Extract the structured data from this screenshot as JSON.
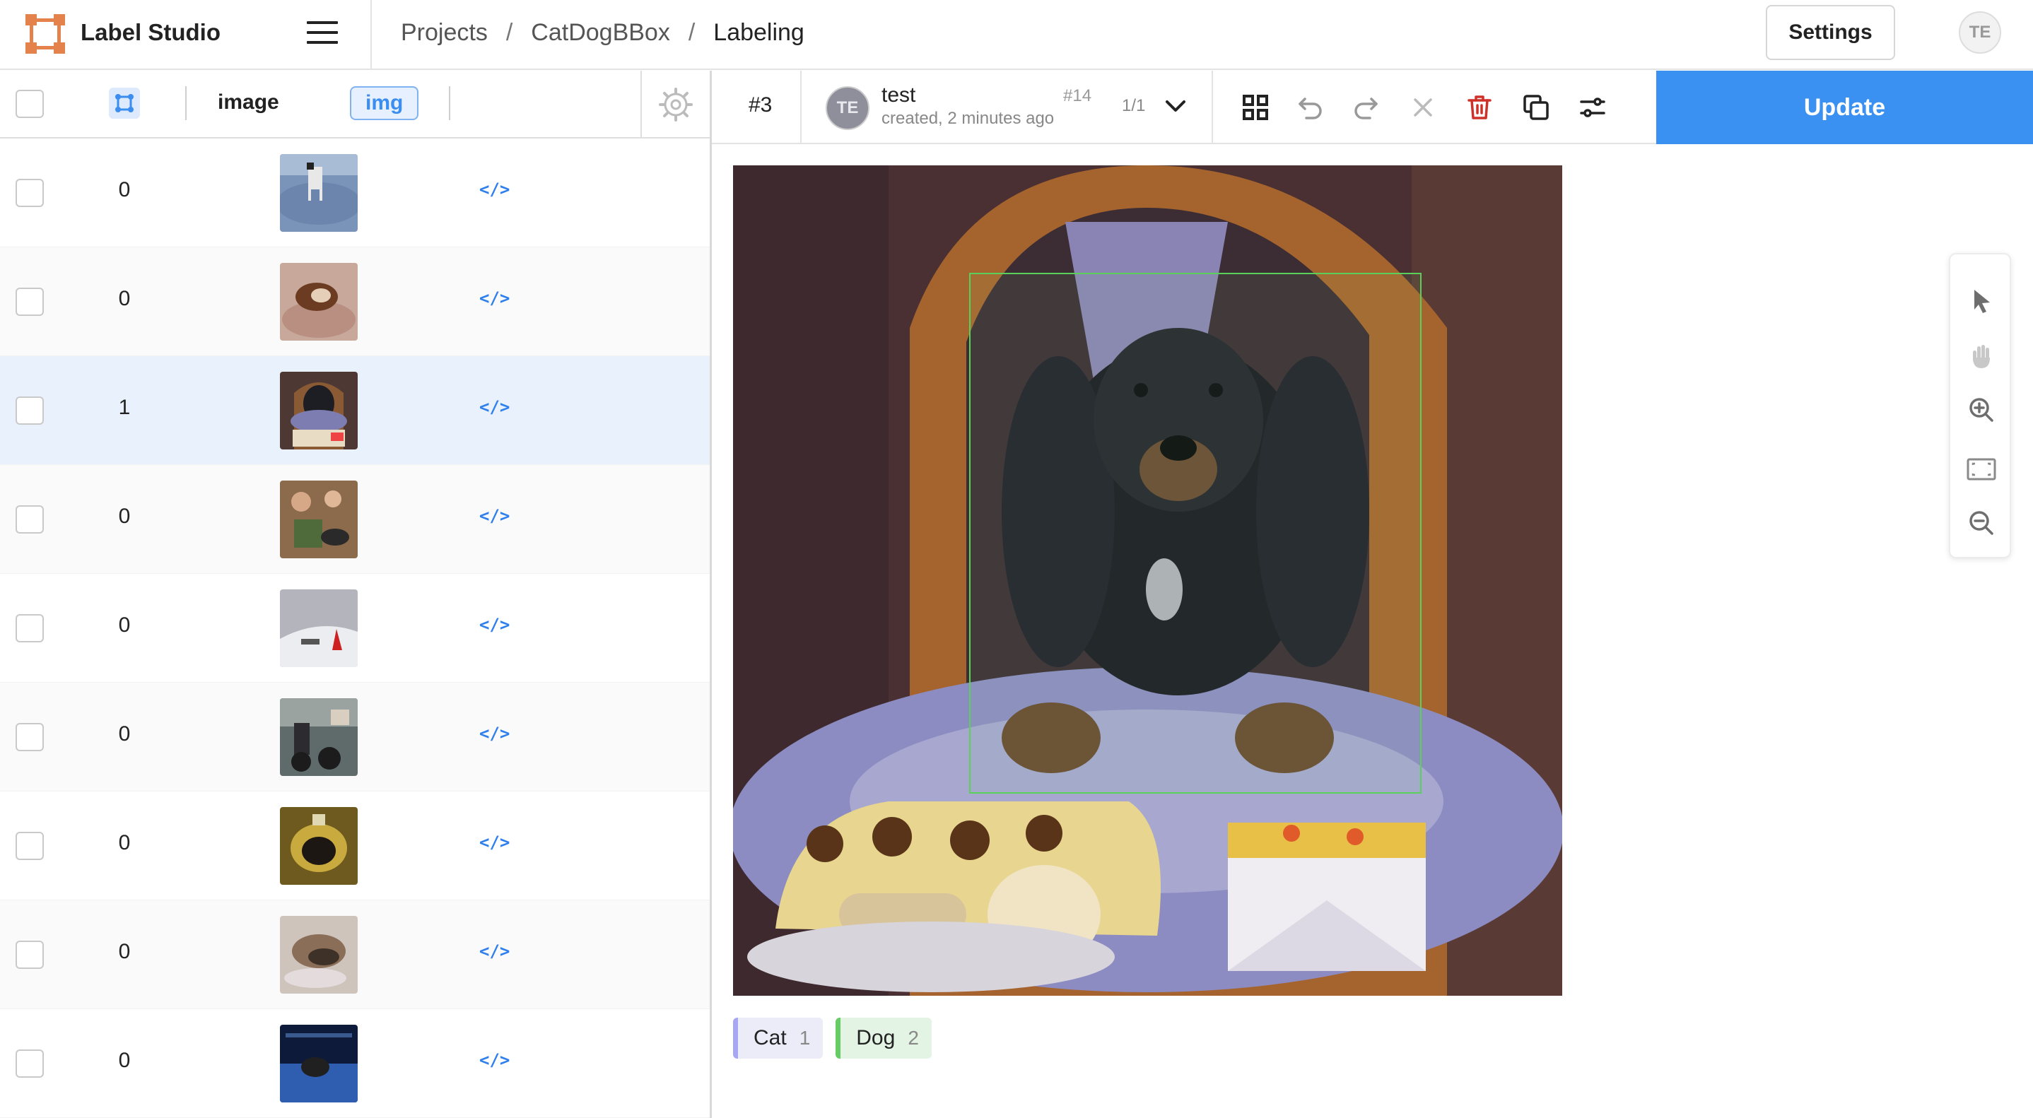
{
  "header": {
    "app_title": "Label Studio",
    "breadcrumb": [
      "Projects",
      "CatDogBBox",
      "Labeling"
    ],
    "breadcrumb_sep": "/",
    "settings_label": "Settings",
    "user_initials": "TE",
    "brand_color": "#e4824c"
  },
  "table": {
    "columns": {
      "image": "image",
      "tag": "img"
    },
    "rows": [
      {
        "value": "0",
        "code": "</>",
        "thumb": "dog-on-ice"
      },
      {
        "value": "0",
        "code": "</>",
        "thumb": "puppy-on-cushion"
      },
      {
        "value": "1",
        "code": "</>",
        "thumb": "dachshund-on-chair",
        "selected": true
      },
      {
        "value": "0",
        "code": "</>",
        "thumb": "people-with-dog"
      },
      {
        "value": "0",
        "code": "</>",
        "thumb": "snowy-slope"
      },
      {
        "value": "0",
        "code": "</>",
        "thumb": "street-scene"
      },
      {
        "value": "0",
        "code": "</>",
        "thumb": "sink-top-view"
      },
      {
        "value": "0",
        "code": "</>",
        "thumb": "sleeping-cat"
      },
      {
        "value": "0",
        "code": "</>",
        "thumb": "dark-blue-scene"
      }
    ]
  },
  "annotation": {
    "task_id": "#3",
    "user_initials": "TE",
    "user_name": "test",
    "created": "created, 2 minutes ago",
    "annotation_id": "#14",
    "count": "1/1",
    "update_label": "Update",
    "update_color": "#3b91f2"
  },
  "labels": [
    {
      "name": "Cat",
      "hotkey": "1",
      "color": "#a6a6f2"
    },
    {
      "name": "Dog",
      "hotkey": "2",
      "color": "#66cc66"
    }
  ],
  "tools": [
    "pointer-icon",
    "pan-hand-icon",
    "zoom-in-icon",
    "fit-to-screen-icon",
    "zoom-out-icon"
  ]
}
